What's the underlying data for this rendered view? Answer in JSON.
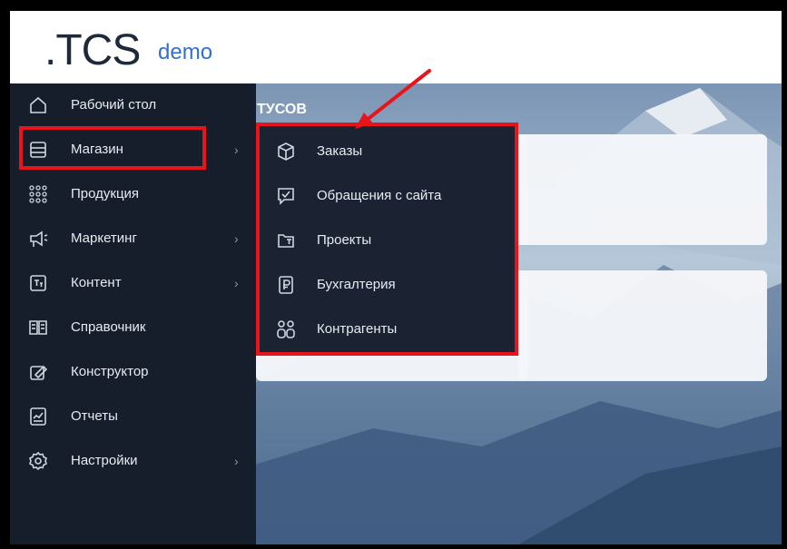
{
  "header": {
    "logo_main": ".TCS",
    "logo_suffix": "demo"
  },
  "main": {
    "section_title_partial": "ТУСОВ"
  },
  "sidebar": {
    "items": [
      {
        "label": "Рабочий стол",
        "icon": "home-icon",
        "has_submenu": false
      },
      {
        "label": "Магазин",
        "icon": "store-icon",
        "has_submenu": true,
        "active": true
      },
      {
        "label": "Продукция",
        "icon": "grid-dots-icon",
        "has_submenu": false
      },
      {
        "label": "Маркетинг",
        "icon": "megaphone-icon",
        "has_submenu": true
      },
      {
        "label": "Контент",
        "icon": "content-icon",
        "has_submenu": true
      },
      {
        "label": "Справочник",
        "icon": "book-icon",
        "has_submenu": false
      },
      {
        "label": "Конструктор",
        "icon": "constructor-icon",
        "has_submenu": false
      },
      {
        "label": "Отчеты",
        "icon": "report-icon",
        "has_submenu": false
      },
      {
        "label": "Настройки",
        "icon": "settings-icon",
        "has_submenu": true
      }
    ],
    "chevron": "›"
  },
  "submenu": {
    "items": [
      {
        "label": "Заказы",
        "icon": "box-icon"
      },
      {
        "label": "Обращения с сайта",
        "icon": "chat-check-icon"
      },
      {
        "label": "Проекты",
        "icon": "projects-icon"
      },
      {
        "label": "Бухгалтерия",
        "icon": "ruble-doc-icon"
      },
      {
        "label": "Контрагенты",
        "icon": "people-icon"
      }
    ]
  },
  "annotation": {
    "highlight_color": "#e8141b"
  }
}
